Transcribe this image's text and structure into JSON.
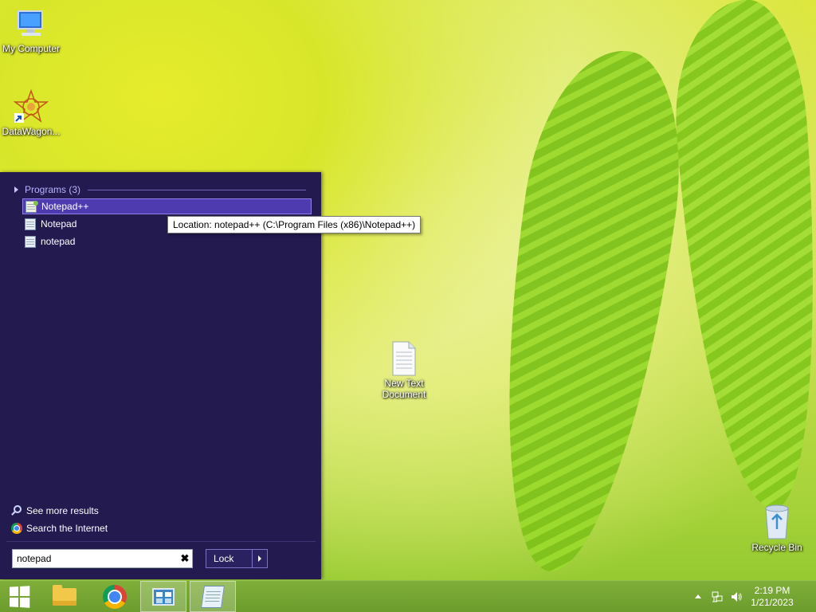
{
  "desktop": {
    "icons": [
      {
        "label": "My Computer"
      },
      {
        "label": "DataWagon..."
      },
      {
        "label": "New Text Document"
      },
      {
        "label": "Recycle Bin"
      }
    ]
  },
  "start_menu": {
    "section_header": "Programs (3)",
    "programs": [
      {
        "label": "Notepad++",
        "selected": true
      },
      {
        "label": "Notepad",
        "selected": false
      },
      {
        "label": "notepad",
        "selected": false
      }
    ],
    "tooltip": "Location: notepad++ (C:\\Program Files (x86)\\Notepad++)",
    "see_more": "See more results",
    "search_internet": "Search the Internet",
    "search": {
      "value": "notepad"
    },
    "lock_button": "Lock",
    "colors": {
      "background": "#231a4f",
      "selection": "#4f3bb0"
    }
  },
  "taskbar": {
    "items": [
      "start",
      "file-explorer",
      "chrome",
      "control-panel",
      "notepad"
    ],
    "clock": {
      "time": "2:19 PM",
      "date": "1/21/2023"
    }
  }
}
